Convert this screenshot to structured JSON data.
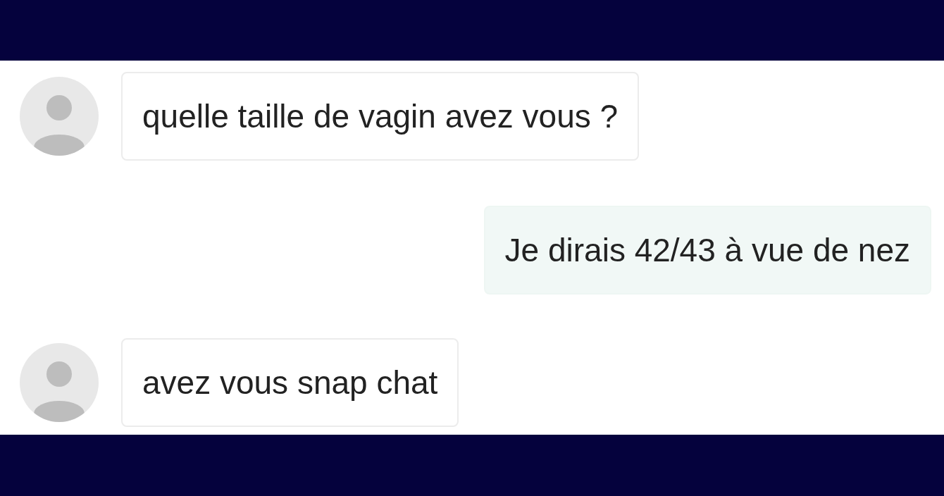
{
  "messages": [
    {
      "kind": "received",
      "text": "quelle taille de vagin avez vous ?"
    },
    {
      "kind": "sent",
      "text": "Je dirais 42/43 à vue de nez"
    },
    {
      "kind": "received",
      "text": "avez vous snap chat"
    }
  ]
}
